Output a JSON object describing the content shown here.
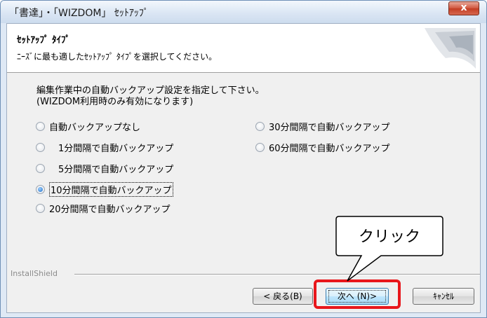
{
  "window": {
    "title": "「書達」・「WIZDOM」 ｾｯﾄｱｯﾌﾟ",
    "close_label": "x"
  },
  "header": {
    "title": "ｾｯﾄｱｯﾌﾟ ﾀｲﾌﾟ",
    "subtitle": "ﾆｰｽﾞに最も適したｾｯﾄｱｯﾌﾟ ﾀｲﾌﾟを選択してください。"
  },
  "instructions": {
    "line1": "編集作業中の自動バックアップ設定を指定して下さい。",
    "line2": "(WIZDOM利用時のみ有効になります)"
  },
  "options": [
    {
      "label": "自動バックアップなし",
      "checked": false
    },
    {
      "label": "　1分間隔で自動バックアップ",
      "checked": false
    },
    {
      "label": "　5分間隔で自動バックアップ",
      "checked": false
    },
    {
      "label": "10分間隔で自動バックアップ",
      "checked": true
    },
    {
      "label": "20分間隔で自動バックアップ",
      "checked": false
    },
    {
      "label": "30分間隔で自動バックアップ",
      "checked": false
    },
    {
      "label": "60分間隔で自動バックアップ",
      "checked": false
    }
  ],
  "footer": {
    "brand": "InstallShield"
  },
  "buttons": {
    "back": "< 戻る(B)",
    "next": "次へ (N)>",
    "cancel": "ｷｬﾝｾﾙ"
  },
  "annotation": {
    "callout_text": "クリック",
    "highlight_color": "#e8161b"
  }
}
